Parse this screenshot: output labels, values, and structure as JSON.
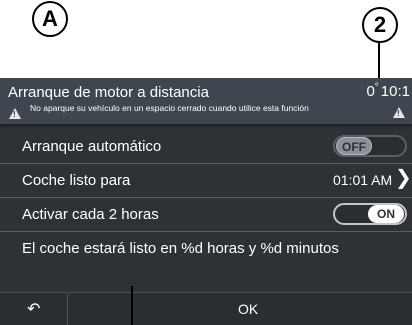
{
  "callouts": {
    "left": "A",
    "right": "2"
  },
  "header": {
    "title": "Arranque de motor a distancia",
    "temperature": "0",
    "degree": "°",
    "time": "10:1",
    "warning": "No aparque su vehículo en un espacio cerrado cuando utilice esta función"
  },
  "rows": {
    "auto_start": {
      "label": "Arranque automático",
      "toggle": "OFF",
      "on": false
    },
    "ready_for": {
      "label": "Coche listo para",
      "value": "01:01 AM"
    },
    "every_two_hours": {
      "label": "Activar cada 2 horas",
      "toggle": "ON",
      "on": true
    },
    "info": {
      "label": "El coche estará listo en %d horas y %d minutos"
    }
  },
  "footer": {
    "back_icon": "back-arrow-icon",
    "ok_label": "OK"
  },
  "colors": {
    "screen_bg": "#2e3237",
    "header_bg": "#3f4650",
    "text": "#ffffff"
  }
}
